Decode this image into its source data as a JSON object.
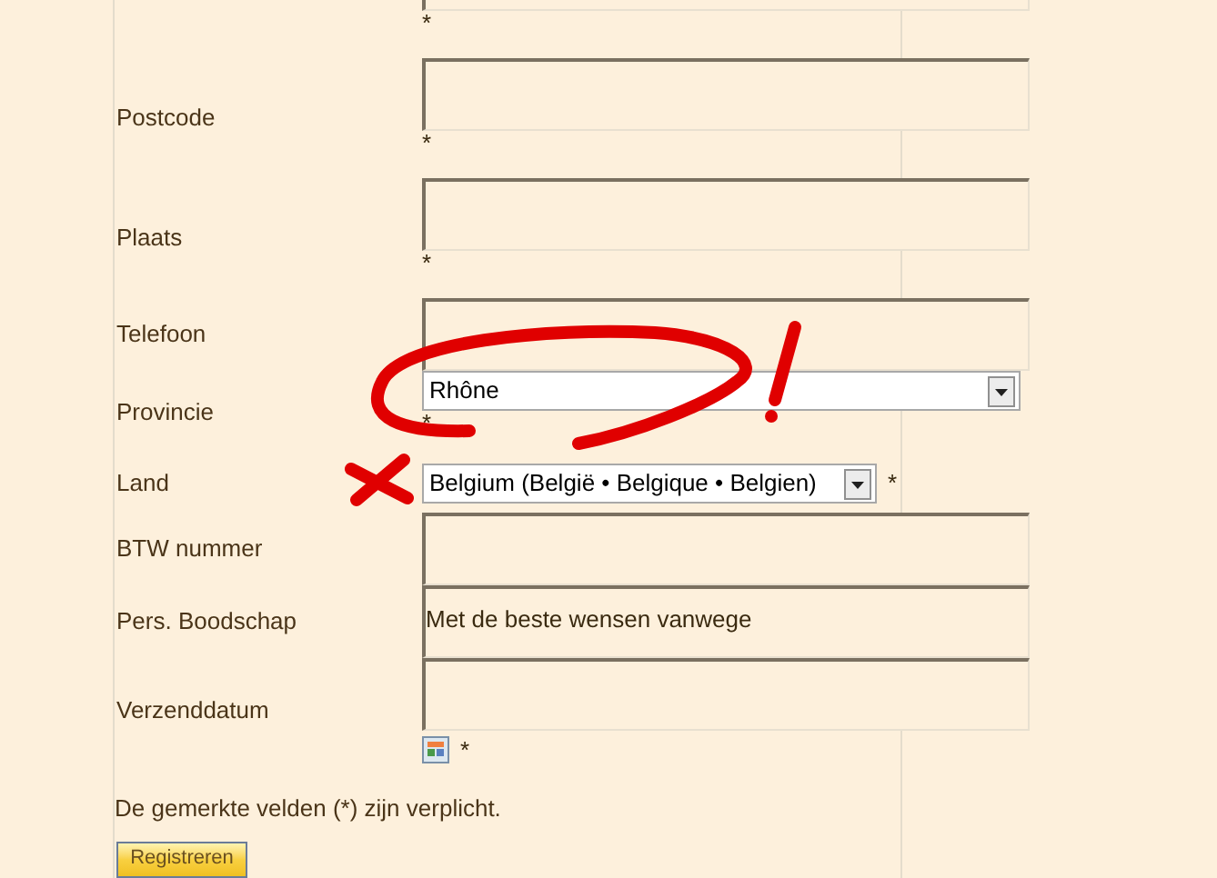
{
  "fields": [
    {
      "kind": "text",
      "mark": "*"
    },
    {
      "kind": "text",
      "label": "Postcode",
      "mark": "*"
    },
    {
      "kind": "text",
      "label": "Plaats",
      "mark": "*"
    },
    {
      "kind": "text",
      "label": "Telefoon"
    },
    {
      "kind": "select",
      "label": "Provincie",
      "value": "Rhône",
      "mark": "*",
      "wide": true
    },
    {
      "kind": "select",
      "label": "Land",
      "value": "Belgium (België • Belgique • Belgien)",
      "mark": "*",
      "wide": false
    },
    {
      "kind": "text",
      "label": "BTW nummer"
    },
    {
      "kind": "text",
      "label": "Pers. Boodschap",
      "value": "Met de beste wensen vanwege"
    },
    {
      "kind": "date",
      "label": "Verzenddatum",
      "mark": "*"
    }
  ],
  "note": "De gemerkte velden (*) zijn verplicht.",
  "submit": "Registreren",
  "annotation": {
    "kind": "scribble"
  }
}
